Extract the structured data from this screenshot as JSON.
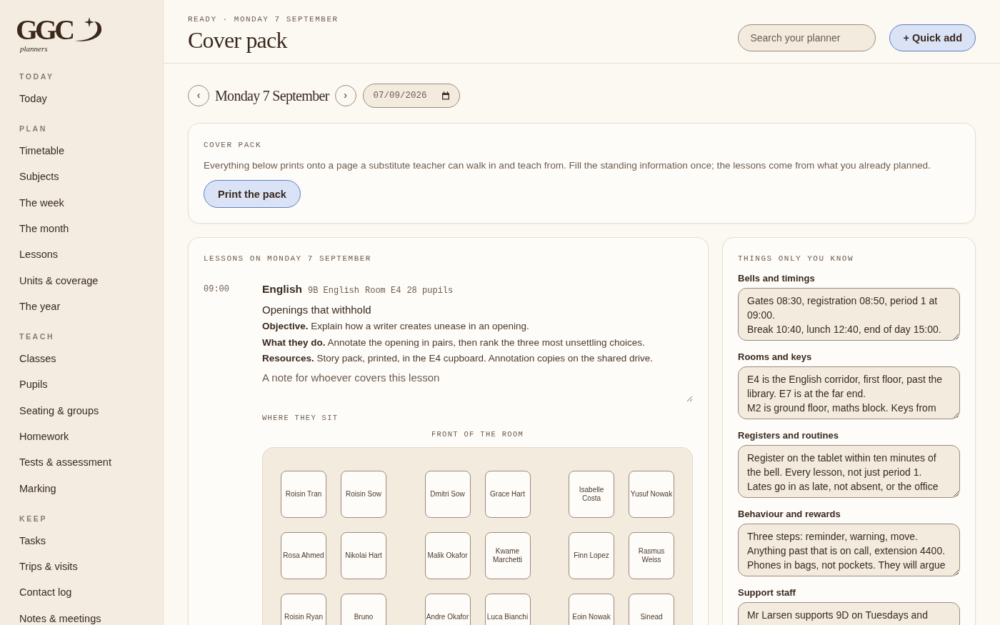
{
  "sidebar": {
    "logo": {
      "wordmark": "GGC",
      "tagline": "planners"
    },
    "sections": [
      {
        "label": "TODAY",
        "items": [
          "Today"
        ]
      },
      {
        "label": "PLAN",
        "items": [
          "Timetable",
          "Subjects",
          "The week",
          "The month",
          "Lessons",
          "Units & coverage",
          "The year"
        ]
      },
      {
        "label": "TEACH",
        "items": [
          "Classes",
          "Pupils",
          "Seating & groups",
          "Homework",
          "Tests & assessment",
          "Marking"
        ]
      },
      {
        "label": "KEEP",
        "items": [
          "Tasks",
          "Trips & visits",
          "Contact log",
          "Notes & meetings"
        ]
      }
    ]
  },
  "header": {
    "status": "READY · MONDAY 7 SEPTEMBER",
    "title": "Cover pack",
    "search": {
      "placeholder": "Search your planner"
    },
    "quick_add": "+ Quick add"
  },
  "date_nav": {
    "prev": "‹",
    "label": "Monday 7 September",
    "next": "›",
    "date_value": "07/09/2026"
  },
  "cover_card": {
    "heading": "COVER PACK",
    "description": "Everything below prints onto a page a substitute teacher can walk in and teach from. Fill the standing information once; the lessons come from what you already planned.",
    "button": "Print the pack"
  },
  "lessons": {
    "heading": "LESSONS ON MONDAY 7 SEPTEMBER",
    "items": [
      {
        "time": "09:00",
        "subject": "English",
        "meta": [
          "9B English",
          "Room E4",
          "28 pupils"
        ],
        "title": "Openings that withhold",
        "details": [
          "**Objective.** Explain how a writer creates unease in an opening.",
          "**What they do.** Annotate the opening in pairs, then rank the three most unsettling choices.",
          "**Resources.** Story pack, printed, in the E4 cupboard. Annotation copies on the shared drive."
        ],
        "note": {
          "placeholder": "A note for whoever covers this lesson"
        },
        "seating": {
          "heading": "WHERE THEY SIT",
          "front_label": "FRONT OF THE ROOM",
          "rows": [
            [
              [
                "Roisin Tran",
                "Roisin Sow"
              ],
              [
                "Dmitri Sow",
                "Grace Hart"
              ],
              [
                "Isabelle Costa",
                "Yusuf Nowak"
              ]
            ],
            [
              [
                "Rosa Ahmed",
                "Nikolai Hart"
              ],
              [
                "Malik Okafor",
                "Kwame Marchetti"
              ],
              [
                "Finn Lopez",
                "Rasmus Weiss"
              ]
            ],
            [
              [
                "Roisin Ryan",
                "Bruno"
              ],
              [
                "Andre Okafor",
                "Luca Bianchi"
              ],
              [
                "Eoin Nowak",
                "Sinead"
              ]
            ]
          ]
        }
      }
    ]
  },
  "standing_info": {
    "heading": "THINGS ONLY YOU KNOW",
    "fields": [
      {
        "label": "Bells and timings",
        "value": "Gates 08:30, registration 08:50, period 1 at 09:00.\nBreak 10:40, lunch 12:40, end of day 15:00."
      },
      {
        "label": "Rooms and keys",
        "value": "E4 is the English corridor, first floor, past the library. E7 is at the far end.\nM2 is ground floor, maths block. Keys from"
      },
      {
        "label": "Registers and routines",
        "value": "Register on the tablet within ten minutes of the bell. Every lesson, not just period 1.\nLates go in as late, not absent, or the office"
      },
      {
        "label": "Behaviour and rewards",
        "value": "Three steps: reminder, warning, move.\nAnything past that is on call, extension 4400.\nPhones in bags, not pockets. They will argue"
      },
      {
        "label": "Support staff",
        "value": "Mr Larsen supports 9D on Tuesdays and"
      }
    ]
  }
}
